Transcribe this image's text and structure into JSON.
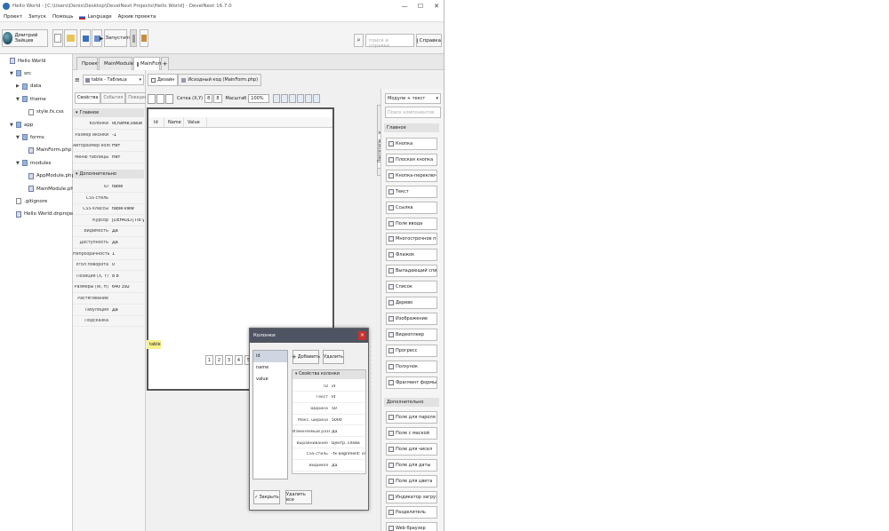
{
  "window": {
    "title": "Hello World - [C:\\Users\\Denis\\Desktop\\DevelNext Projects\\Hello World] - DevelNext 16.7.0",
    "controls": [
      "—",
      "☐",
      "✕"
    ]
  },
  "menu": [
    "Проект",
    "Запуск",
    "Помощь",
    "Language",
    "Архив проекта"
  ],
  "toolbar": {
    "user": "Дмитрий Зайцев",
    "run_label": "Запустить",
    "search_placeholder": "поиск в справке",
    "help_label": "Справка"
  },
  "tree": [
    {
      "label": "Hello World",
      "tw": "",
      "icon": "php",
      "indent": 0
    },
    {
      "label": "src",
      "tw": "▼",
      "icon": "folder",
      "indent": 1
    },
    {
      "label": "data",
      "tw": "▶",
      "icon": "folder",
      "indent": 2
    },
    {
      "label": "theme",
      "tw": "▼",
      "icon": "folder",
      "indent": 2
    },
    {
      "label": "style.fx.css",
      "tw": "",
      "icon": "file",
      "indent": 3
    },
    {
      "label": "app",
      "tw": "▼",
      "icon": "folder",
      "indent": 1
    },
    {
      "label": "forms",
      "tw": "▼",
      "icon": "folder",
      "indent": 2
    },
    {
      "label": "MainForm.php",
      "tw": "",
      "icon": "php",
      "indent": 3
    },
    {
      "label": "modules",
      "tw": "▼",
      "icon": "folder",
      "indent": 2
    },
    {
      "label": "AppModule.php",
      "tw": "",
      "icon": "php",
      "indent": 3
    },
    {
      "label": "MainModule.php",
      "tw": "",
      "icon": "php",
      "indent": 3
    },
    {
      "label": ".gitignore",
      "tw": "",
      "icon": "file",
      "indent": 1
    },
    {
      "label": "Hello World.dnproject",
      "tw": "",
      "icon": "php",
      "indent": 1
    }
  ],
  "tabs": [
    "Проект",
    "MainModule",
    "MainForm"
  ],
  "object_selector": "table - Таблица",
  "prop_tabs": [
    "Свойства",
    "События",
    "Поведения"
  ],
  "props_main_header": "Главное",
  "props_main": [
    {
      "k": "Колонки",
      "v": "id,name,value"
    },
    {
      "k": "Размер иконки",
      "v": "-1"
    },
    {
      "k": "Авторазмер колонок",
      "v": "Нет"
    },
    {
      "k": "Меню таблицы",
      "v": "Нет"
    }
  ],
  "props_extra_header": "Дополнительно",
  "props_extra": [
    {
      "k": "ID",
      "v": "table"
    },
    {
      "k": "CSS стиль",
      "v": ""
    },
    {
      "k": "CSS классы",
      "v": "table-view"
    },
    {
      "k": "Курсор",
      "v": "[DEFAULT] По ум..."
    },
    {
      "k": "Видимость",
      "v": "Да"
    },
    {
      "k": "Доступность",
      "v": "Да"
    },
    {
      "k": "Непрозрачность",
      "v": "1"
    },
    {
      "k": "Угол поворота",
      "v": "0"
    },
    {
      "k": "Позиция (X, Y)",
      "v": "8    8"
    },
    {
      "k": "Размеры (W, H)",
      "v": "640  392"
    },
    {
      "k": "Растягивание",
      "v": ""
    },
    {
      "k": "Табуляция",
      "v": "Да"
    },
    {
      "k": "Подсказка",
      "v": ""
    }
  ],
  "editor_tabs": [
    "Дизайн",
    "Исходный код (MainForm.php)"
  ],
  "editor_toolbar": {
    "grid_label": "Сетка (X,Y)",
    "grid_x": "8",
    "grid_y": "8",
    "zoom_label": "Масштаб",
    "zoom": "100%"
  },
  "table_headers": [
    "Id",
    "Name",
    "Value"
  ],
  "selected_label": "table",
  "pages": [
    "1",
    "2",
    "3",
    "4",
    "5"
  ],
  "components": {
    "filter": "Модули + текст",
    "search_placeholder": "Поиск компонентов",
    "side_tab": "Объекты",
    "side_tab2": "Прототипы",
    "main_header": "Главное",
    "main": [
      "Кнопка",
      "Плоская кнопка",
      "Кнопка-переключатель",
      "Текст",
      "Ссылка",
      "Поле ввода",
      "Многострочное поле",
      "Флажок",
      "Выпадающий список",
      "Список",
      "Дерево",
      "Изображение",
      "Видеоплеер",
      "Прогресс",
      "Ползунок",
      "Фрагмент формы"
    ],
    "extra_header": "Дополнительно",
    "extra": [
      "Поле для пароля",
      "Поле с маской",
      "Поле для чисел",
      "Поле для даты",
      "Поле для цвета",
      "Индикатор загрузки",
      "Разделитель",
      "Web браузер"
    ]
  },
  "dialog": {
    "title": "Колонки",
    "columns": [
      "id",
      "name",
      "value"
    ],
    "add": "Добавить",
    "delete": "Удалить",
    "props_header": "Свойства колонки",
    "props": [
      {
        "k": "ID",
        "v": "id"
      },
      {
        "k": "Текст",
        "v": "Id"
      },
      {
        "k": "Ширина",
        "v": "50"
      },
      {
        "k": "Макс. ширина",
        "v": "5000"
      },
      {
        "k": "Изменяемый размер",
        "v": "Да"
      },
      {
        "k": "Выравнивание",
        "v": "Центр. слева"
      },
      {
        "k": "CSS стиль",
        "v": "-fx-alignment: center"
      },
      {
        "k": "Видимая",
        "v": "Да"
      }
    ],
    "close": "Закрыть",
    "delete_all": "Удалить все"
  }
}
